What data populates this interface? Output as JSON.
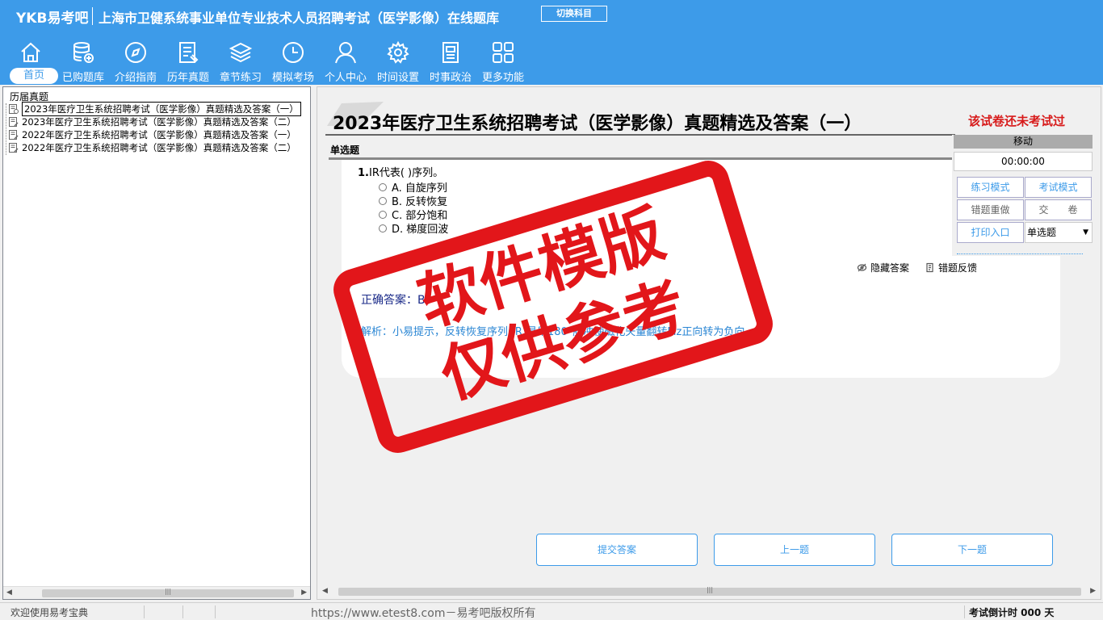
{
  "header": {
    "logo": "YKB易考吧",
    "title": "上海市卫健系统事业单位专业技术人员招聘考试（医学影像）在线题库",
    "switch_label": "切换科目"
  },
  "nav": [
    {
      "label": "首页",
      "icon": "home-icon"
    },
    {
      "label": "已购题库",
      "icon": "database-icon"
    },
    {
      "label": "介绍指南",
      "icon": "compass-icon"
    },
    {
      "label": "历年真题",
      "icon": "document-list-icon"
    },
    {
      "label": "章节练习",
      "icon": "layers-icon"
    },
    {
      "label": "模拟考场",
      "icon": "clock-icon"
    },
    {
      "label": "个人中心",
      "icon": "user-icon"
    },
    {
      "label": "时间设置",
      "icon": "gear-icon"
    },
    {
      "label": "时事政治",
      "icon": "newspaper-icon"
    },
    {
      "label": "更多功能",
      "icon": "grid-icon"
    }
  ],
  "tree": {
    "root": "历届真题",
    "items": [
      "2023年医疗卫生系统招聘考试（医学影像）真题精选及答案（一）",
      "2023年医疗卫生系统招聘考试（医学影像）真题精选及答案（二）",
      "2022年医疗卫生系统招聘考试（医学影像）真题精选及答案（一）",
      "2022年医疗卫生系统招聘考试（医学影像）真题精选及答案（二）"
    ]
  },
  "paper": {
    "title": "2023年医疗卫生系统招聘考试（医学影像）真题精选及答案（一）",
    "status": "该试卷还未考试过",
    "section": "单选题"
  },
  "question": {
    "number": "1.",
    "text": "IR代表( )序列。",
    "options": [
      "A. 自旋序列",
      "B. 反转恢复",
      "C. 部分饱和",
      "D. 梯度回波"
    ],
    "answer": "正确答案：B",
    "analysis": "解析：小易提示，反转恢复序列(IR)是用180°脉冲使磁化矢量翻转Mz正向转为负向。",
    "hide_answer": "隐藏答案",
    "feedback": "错题反馈"
  },
  "actions": {
    "submit": "提交答案",
    "prev": "上一题",
    "next": "下一题"
  },
  "control": {
    "move": "移动",
    "timer": "00:00:00",
    "practice": "练习模式",
    "exam": "考试模式",
    "redo": "错题重做",
    "hand_in": "交　　卷",
    "print": "打印入口",
    "type_select": "单选题"
  },
  "watermark": {
    "line1": "软件模版",
    "line2": "仅供参考"
  },
  "status": {
    "welcome": "欢迎使用易考宝典",
    "copyright": "https://www.etest8.com－易考吧版权所有",
    "countdown": "考试倒计时 000 天"
  },
  "colors": {
    "brand": "#3d9be9",
    "stamp": "#e2161a",
    "alert": "#d71a1a"
  }
}
